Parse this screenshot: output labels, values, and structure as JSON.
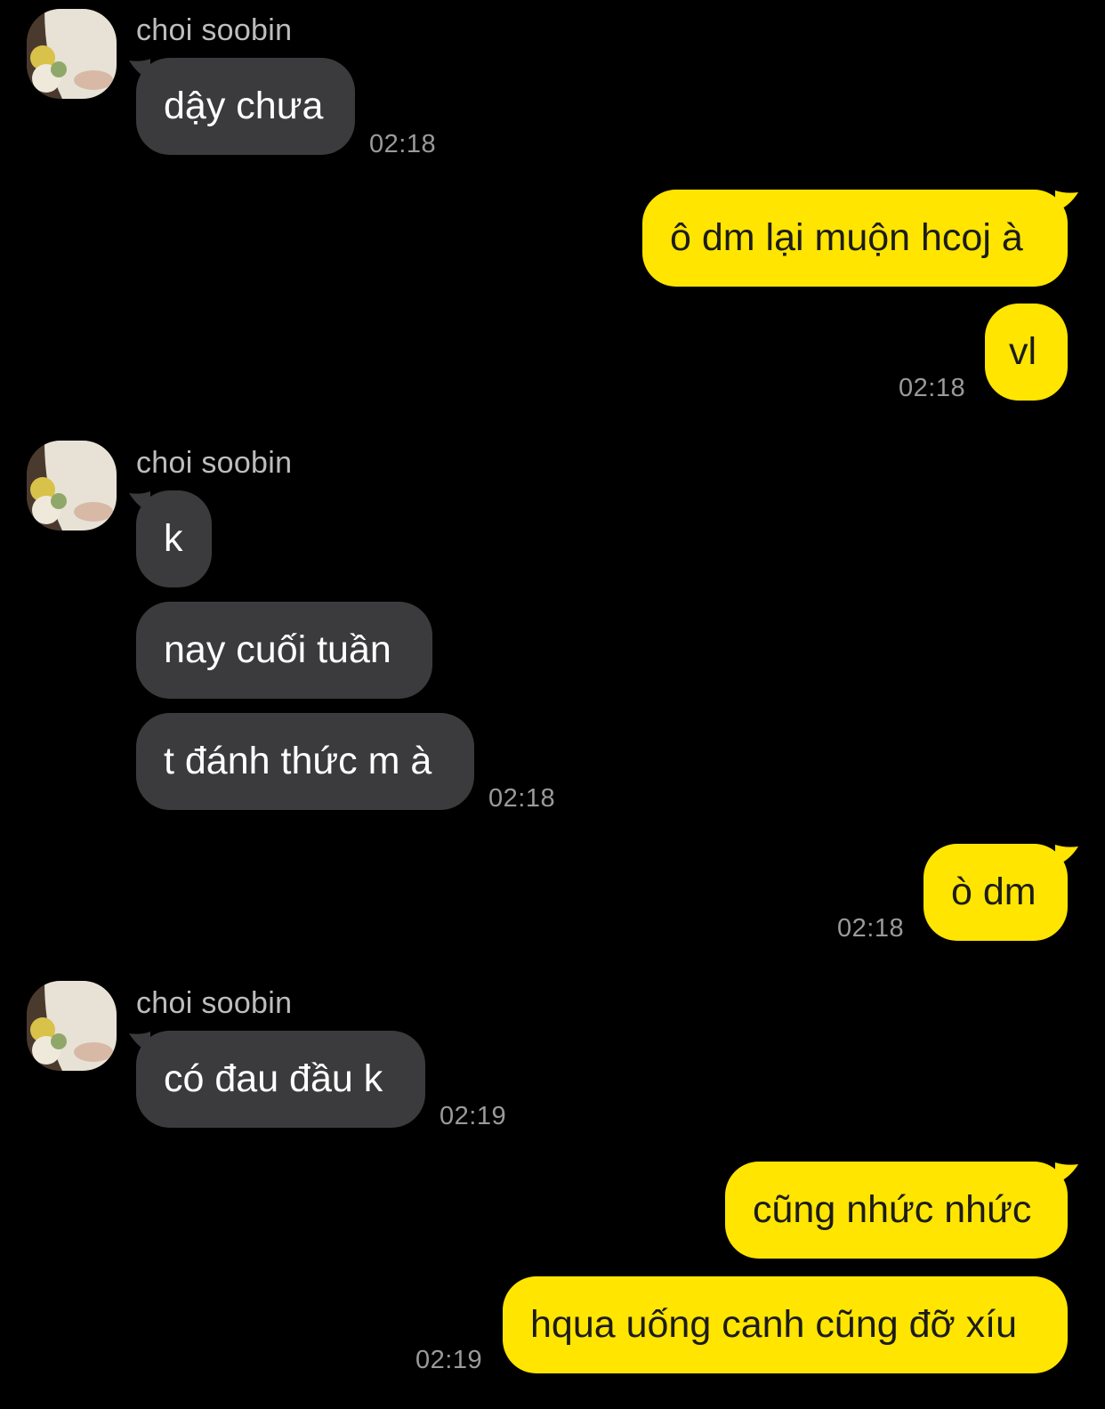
{
  "chat": {
    "contact_name": "choi soobin",
    "groups": [
      {
        "sender": "choi soobin",
        "messages": [
          "dậy chưa"
        ],
        "time": "02:18"
      },
      {
        "sender": "me",
        "messages": [
          "ô dm lại muộn hcoj à",
          "vl"
        ],
        "time": "02:18"
      },
      {
        "sender": "choi soobin",
        "messages": [
          "k",
          "nay cuối tuần",
          "t đánh thức m à"
        ],
        "time": "02:18"
      },
      {
        "sender": "me",
        "messages": [
          "ò dm"
        ],
        "time": "02:18"
      },
      {
        "sender": "choi soobin",
        "messages": [
          "có đau đầu k"
        ],
        "time": "02:19"
      },
      {
        "sender": "me",
        "messages": [
          "cũng nhức nhức",
          "hqua uống canh cũng đỡ xíu"
        ],
        "time": "02:19"
      }
    ]
  },
  "colors": {
    "background": "#000000",
    "incoming_bubble": "#3b3b3d",
    "outgoing_bubble": "#ffe500",
    "timestamp": "#9a9a9a"
  }
}
